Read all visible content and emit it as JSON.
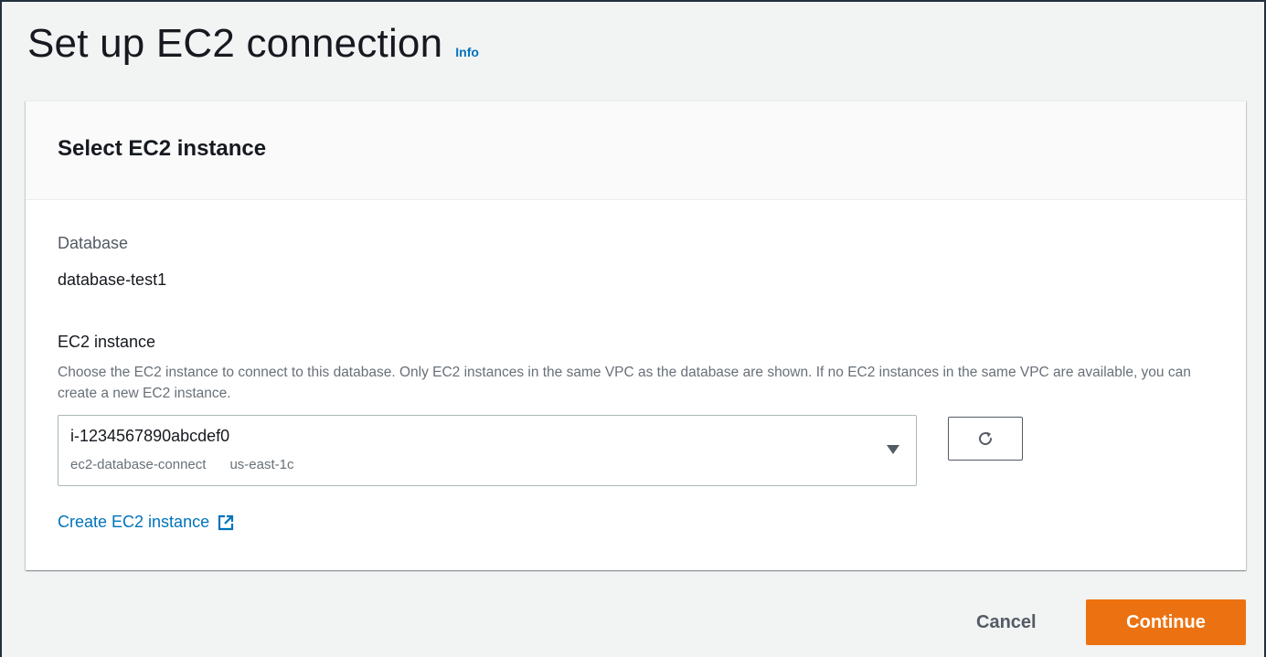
{
  "header": {
    "title": "Set up EC2 connection",
    "info_label": "Info"
  },
  "panel": {
    "title": "Select EC2 instance",
    "database": {
      "label": "Database",
      "value": "database-test1"
    },
    "ec2": {
      "label": "EC2 instance",
      "description": "Choose the EC2 instance to connect to this database. Only EC2 instances in the same VPC as the database are shown. If no EC2 instances in the same VPC are available, you can create a new EC2 instance.",
      "selected_id": "i-1234567890abcdef0",
      "selected_name": "ec2-database-connect",
      "selected_zone": "us-east-1c"
    },
    "create_link": "Create EC2 instance"
  },
  "footer": {
    "cancel_label": "Cancel",
    "continue_label": "Continue"
  },
  "colors": {
    "accent_link": "#0073bb",
    "primary_button": "#ec7211",
    "background": "#f2f3f3"
  },
  "icons": {
    "refresh": "refresh-icon",
    "external": "external-link-icon",
    "dropdown": "caret-down-icon"
  }
}
